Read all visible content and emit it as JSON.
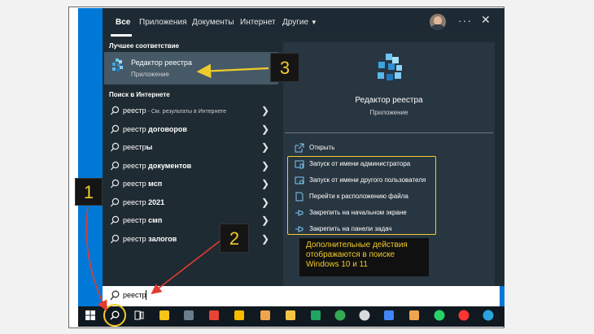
{
  "tabs": {
    "all": "Все",
    "apps": "Приложения",
    "docs": "Документы",
    "web": "Интернет",
    "more": "Другие"
  },
  "best_match": {
    "title": "Лучшее соответствие",
    "name": "Редактор реестра",
    "type": "Приложение"
  },
  "web_section": {
    "title": "Поиск в Интернете",
    "items": [
      {
        "query": "реестр",
        "bold": "",
        "suffix": " - См. результаты в Интернете"
      },
      {
        "query": "реестр ",
        "bold": "договоров",
        "suffix": ""
      },
      {
        "query": "реестр",
        "bold": "ы",
        "suffix": ""
      },
      {
        "query": "реестр ",
        "bold": "документов",
        "suffix": ""
      },
      {
        "query": "реестр ",
        "bold": "мсп",
        "suffix": ""
      },
      {
        "query": "реестр ",
        "bold": "2021",
        "suffix": ""
      },
      {
        "query": "реестр ",
        "bold": "смп",
        "suffix": ""
      },
      {
        "query": "реестр ",
        "bold": "залогов",
        "suffix": ""
      }
    ]
  },
  "preview": {
    "name": "Редактор реестра",
    "type": "Приложение",
    "actions": [
      {
        "label": "Открыть",
        "icon": "open-icon"
      },
      {
        "label": "Запуск от имени администратора",
        "icon": "run-as-admin-icon"
      },
      {
        "label": "Запуск от имени другого пользователя",
        "icon": "run-as-user-icon"
      },
      {
        "label": "Перейти к расположению файла",
        "icon": "file-location-icon"
      },
      {
        "label": "Закрепить на начальном экране",
        "icon": "pin-icon"
      },
      {
        "label": "Закрепить на панели задач",
        "icon": "pin-icon"
      }
    ]
  },
  "search": {
    "value": "реестр"
  },
  "annotations": {
    "n1": "1",
    "n2": "2",
    "n3": "3",
    "note_line1": "Дополнительные действия",
    "note_line2": "отображаются в поиске",
    "note_line3": "Windows 10 и 11"
  },
  "colors": {
    "accent": "#0078d7",
    "highlight": "#f0cb2b",
    "panel": "#1f2b33"
  },
  "taskbar_icons": [
    "windows-start-icon",
    "search-icon",
    "task-view-icon",
    "sticky-notes-icon",
    "calculator-icon",
    "gmail-icon",
    "google-keep-icon",
    "app-icon",
    "file-explorer-icon",
    "google-drive-icon",
    "chrome-icon",
    "clock-icon",
    "google-docs-icon",
    "app-icon",
    "whatsapp-icon",
    "yandex-browser-icon",
    "telegram-icon",
    "settings-icon"
  ]
}
